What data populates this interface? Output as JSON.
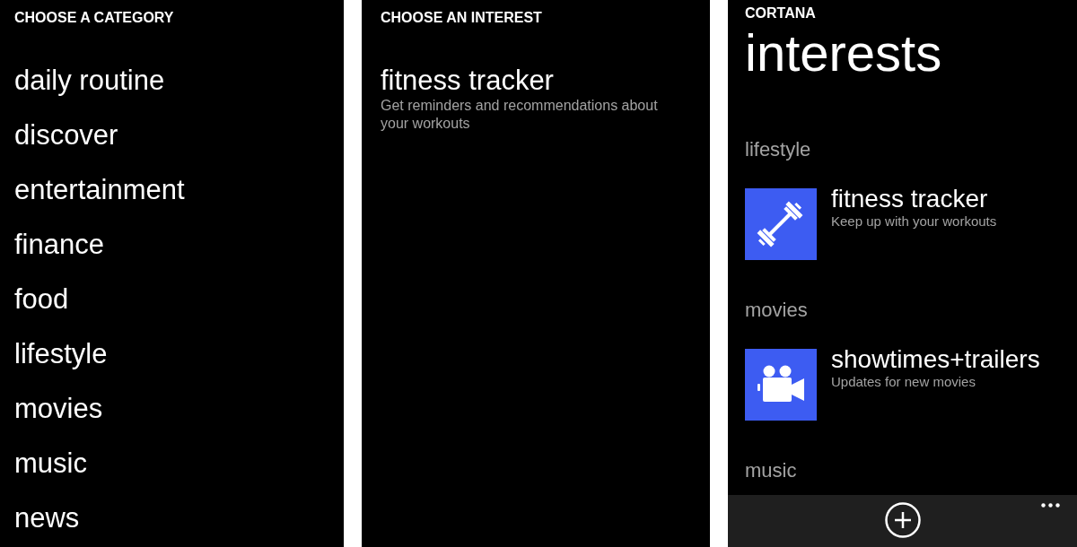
{
  "screens": [
    {
      "kind": "category_list",
      "header": "CHOOSE A CATEGORY",
      "items": [
        "daily routine",
        "discover",
        "entertainment",
        "finance",
        "food",
        "lifestyle",
        "movies",
        "music",
        "news"
      ]
    },
    {
      "kind": "interest_list",
      "header": "CHOOSE AN INTEREST",
      "items": [
        {
          "title": "fitness tracker",
          "description": "Get reminders and recommendations about your workouts"
        }
      ]
    },
    {
      "kind": "interests_page",
      "app_name": "CORTANA",
      "title": "interests",
      "groups": [
        {
          "heading": "lifestyle",
          "items": [
            {
              "kind": "fitness",
              "title": "fitness tracker",
              "subtitle": "Keep up with your workouts"
            }
          ]
        },
        {
          "heading": "movies",
          "items": [
            {
              "kind": "movies",
              "title": "showtimes+trailers",
              "subtitle": "Updates for new movies"
            }
          ]
        },
        {
          "heading": "music"
        }
      ]
    }
  ]
}
